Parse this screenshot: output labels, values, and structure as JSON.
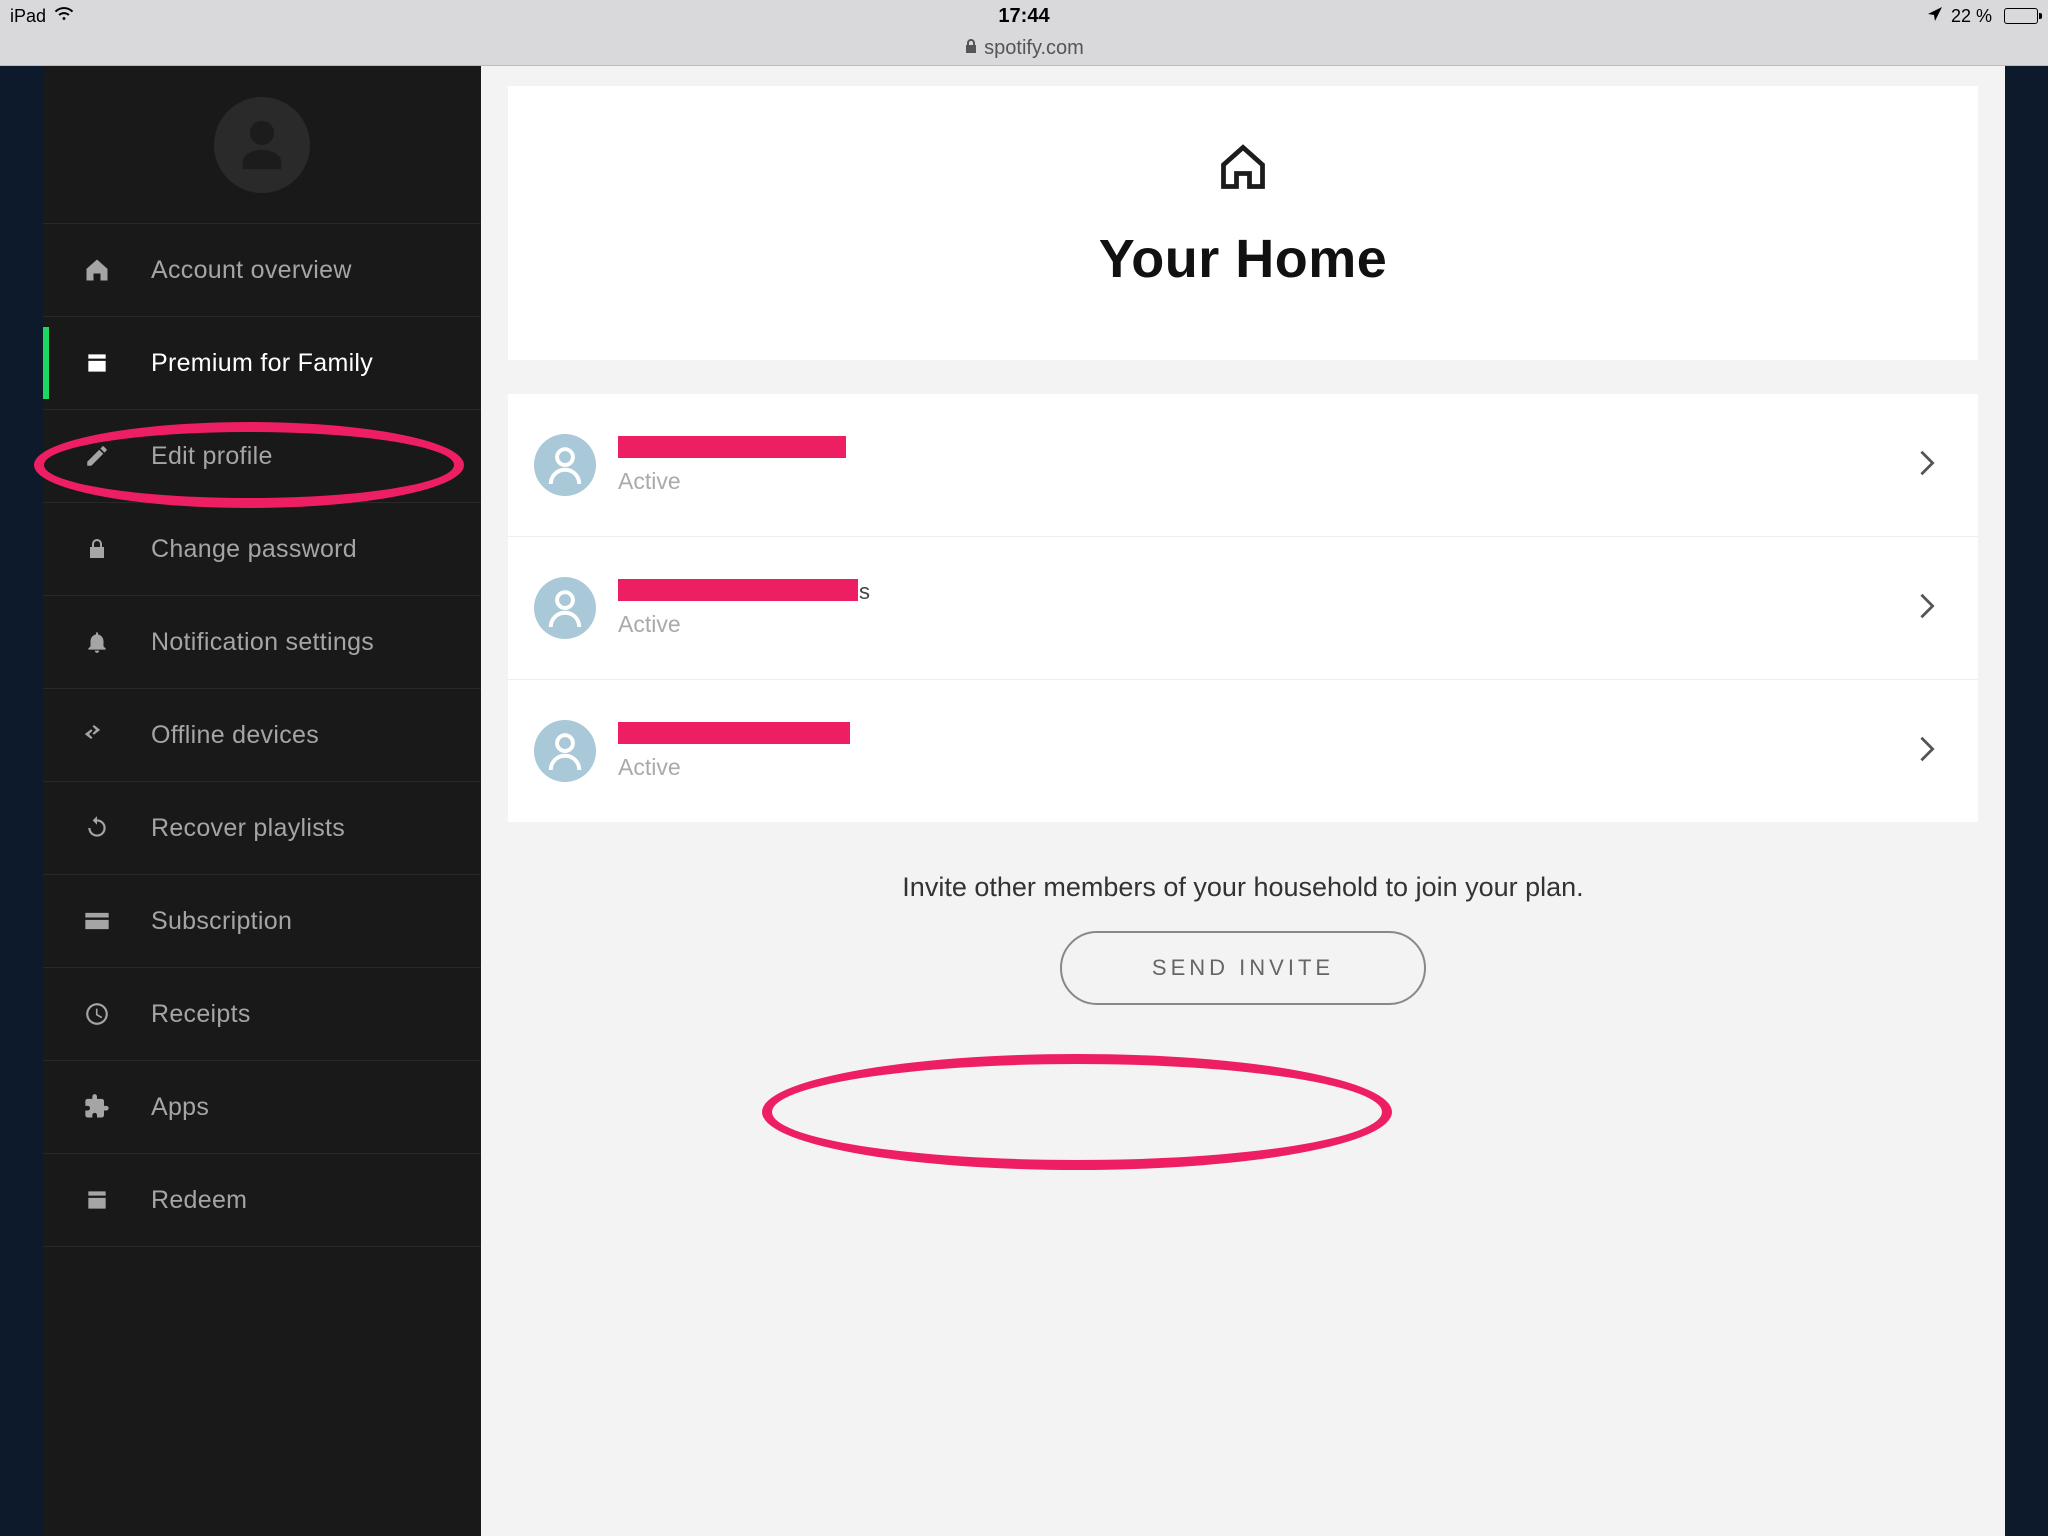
{
  "status_bar": {
    "device": "iPad",
    "time": "17:44",
    "battery_percent": "22 %"
  },
  "url_bar": {
    "domain": "spotify.com"
  },
  "sidebar": {
    "items": [
      {
        "id": "account-overview",
        "label": "Account overview",
        "icon": "home",
        "active": false
      },
      {
        "id": "premium-family",
        "label": "Premium for Family",
        "icon": "card",
        "active": true
      },
      {
        "id": "edit-profile",
        "label": "Edit profile",
        "icon": "pencil",
        "active": false
      },
      {
        "id": "change-password",
        "label": "Change password",
        "icon": "lock",
        "active": false
      },
      {
        "id": "notification-settings",
        "label": "Notification settings",
        "icon": "bell",
        "active": false
      },
      {
        "id": "offline-devices",
        "label": "Offline devices",
        "icon": "swap",
        "active": false
      },
      {
        "id": "recover-playlists",
        "label": "Recover playlists",
        "icon": "reload",
        "active": false
      },
      {
        "id": "subscription",
        "label": "Subscription",
        "icon": "credit",
        "active": false
      },
      {
        "id": "receipts",
        "label": "Receipts",
        "icon": "clock",
        "active": false
      },
      {
        "id": "apps",
        "label": "Apps",
        "icon": "puzzle",
        "active": false
      },
      {
        "id": "redeem",
        "label": "Redeem",
        "icon": "card",
        "active": false
      }
    ]
  },
  "main": {
    "title": "Your Home",
    "members": [
      {
        "status": "Active",
        "redacted": true
      },
      {
        "status": "Active",
        "redacted": true,
        "trail": "s"
      },
      {
        "status": "Active",
        "redacted": true
      }
    ],
    "invite_text": "Invite other members of your household to join your plan.",
    "invite_button": "SEND INVITE"
  },
  "annotations": {
    "highlight_sidebar_item": "premium-family",
    "highlight_button": "send-invite"
  }
}
